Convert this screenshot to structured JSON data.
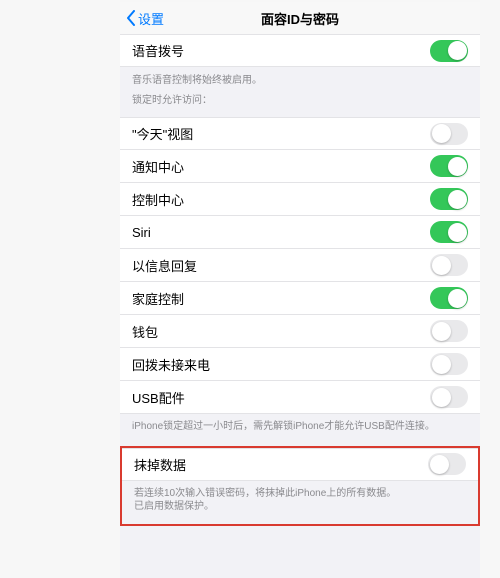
{
  "nav": {
    "back_label": "设置",
    "title": "面容ID与密码"
  },
  "section1": {
    "rows": [
      {
        "label": "语音拨号",
        "on": true
      }
    ],
    "footer_line1": "音乐语音控制将始终被启用。",
    "footer_line2": "锁定时允许访问："
  },
  "section2": {
    "rows": [
      {
        "label": "\"今天\"视图",
        "on": false
      },
      {
        "label": "通知中心",
        "on": true
      },
      {
        "label": "控制中心",
        "on": true
      },
      {
        "label": "Siri",
        "on": true
      },
      {
        "label": "以信息回复",
        "on": false
      },
      {
        "label": "家庭控制",
        "on": true
      },
      {
        "label": "钱包",
        "on": false
      },
      {
        "label": "回拨未接来电",
        "on": false
      },
      {
        "label": "USB配件",
        "on": false
      }
    ],
    "footer": "iPhone锁定超过一小时后，需先解锁iPhone才能允许USB配件连接。"
  },
  "section3": {
    "rows": [
      {
        "label": "抹掉数据",
        "on": false
      }
    ],
    "footer_line1": "若连续10次输入错误密码，将抹掉此iPhone上的所有数据。",
    "footer_line2": "已启用数据保护。"
  }
}
